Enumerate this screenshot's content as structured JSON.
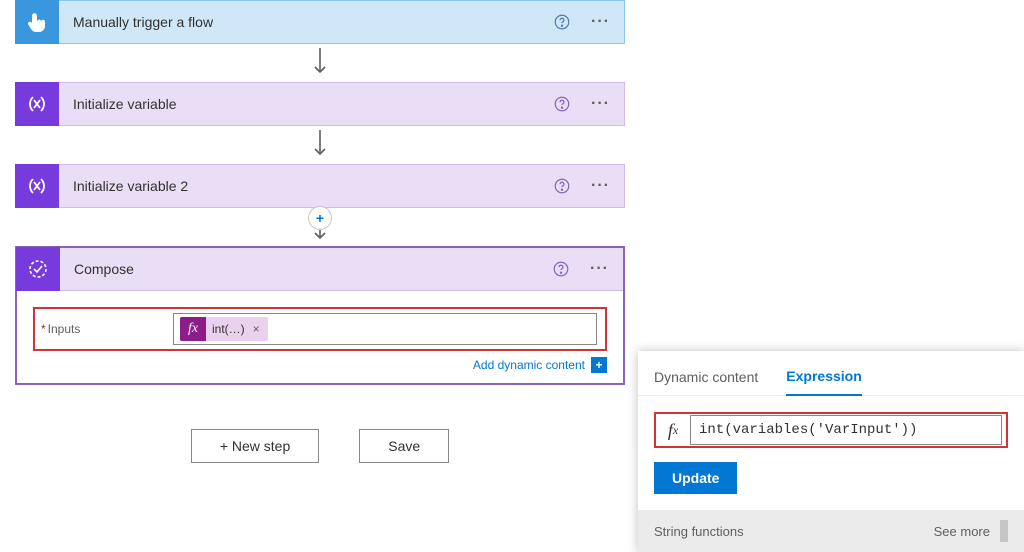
{
  "steps": {
    "trigger": {
      "title": "Manually trigger a flow"
    },
    "initVar": {
      "title": "Initialize variable"
    },
    "initVar2": {
      "title": "Initialize variable 2"
    }
  },
  "compose": {
    "title": "Compose",
    "inputsLabel": "Inputs",
    "token": "int(…)",
    "addDynamic": "Add dynamic content"
  },
  "buttons": {
    "newStep": "+ New step",
    "save": "Save"
  },
  "panel": {
    "tabDynamic": "Dynamic content",
    "tabExpression": "Expression",
    "expression": "int(variables('VarInput'))",
    "update": "Update",
    "section": "String functions",
    "seeMore": "See more"
  }
}
